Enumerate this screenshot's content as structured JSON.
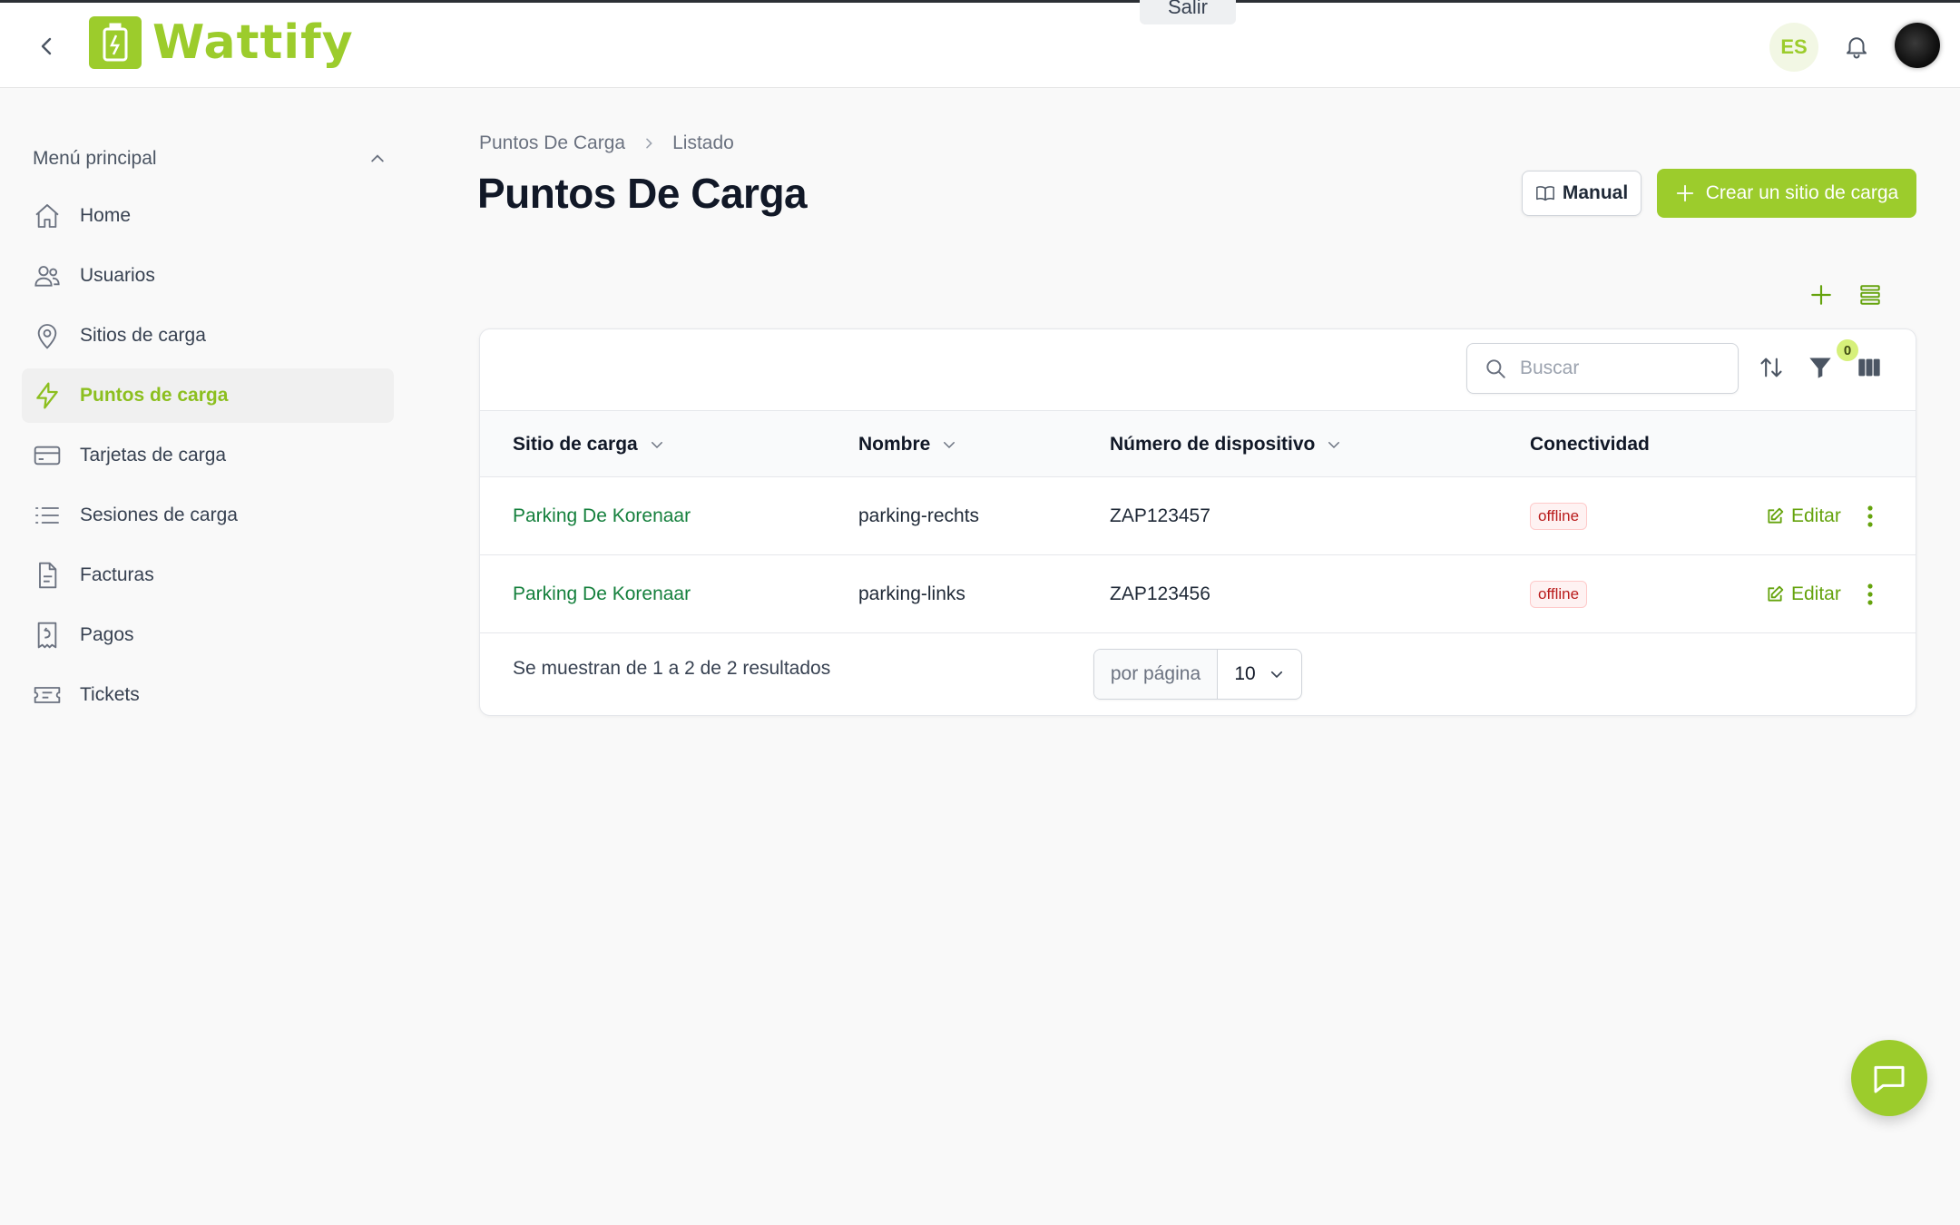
{
  "header": {
    "brand": "Wattify",
    "notice_text": "",
    "notice_button": "Salir",
    "language": "ES"
  },
  "sidebar": {
    "section_title": "Menú principal",
    "items": [
      {
        "label": "Home",
        "icon": "home-icon"
      },
      {
        "label": "Usuarios",
        "icon": "users-icon"
      },
      {
        "label": "Sitios de carga",
        "icon": "map-pin-icon"
      },
      {
        "label": "Puntos de carga",
        "icon": "bolt-icon",
        "active": true
      },
      {
        "label": "Tarjetas de carga",
        "icon": "card-icon"
      },
      {
        "label": "Sesiones de carga",
        "icon": "list-icon"
      },
      {
        "label": "Facturas",
        "icon": "document-icon"
      },
      {
        "label": "Pagos",
        "icon": "receipt-icon"
      },
      {
        "label": "Tickets",
        "icon": "ticket-icon"
      }
    ]
  },
  "breadcrumb": [
    "Puntos De Carga",
    "Listado"
  ],
  "page": {
    "title": "Puntos De Carga",
    "manual_label": "Manual",
    "create_label": "Crear un sitio de carga"
  },
  "table": {
    "search_placeholder": "Buscar",
    "filter_count": "0",
    "columns": [
      "Sitio de carga",
      "Nombre",
      "Número de dispositivo",
      "Conectividad"
    ],
    "rows": [
      {
        "site": "Parking De Korenaar",
        "name": "parking-rechts",
        "device": "ZAP123457",
        "status": "offline",
        "action": "Editar"
      },
      {
        "site": "Parking De Korenaar",
        "name": "parking-links",
        "device": "ZAP123456",
        "status": "offline",
        "action": "Editar"
      }
    ],
    "summary": "Se muestran de 1 a 2 de 2 resultados",
    "per_page_label": "por página",
    "per_page_value": "10"
  },
  "colors": {
    "accent": "#9ccc2c",
    "link": "#15803d",
    "danger": "#b91c1c"
  }
}
